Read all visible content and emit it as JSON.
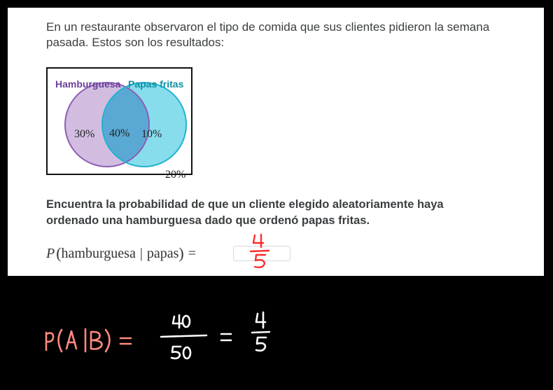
{
  "problem": {
    "intro": "En un restaurante observaron el tipo de comida que sus clientes pidieron la semana pasada. Estos son los resultados:",
    "venn": {
      "set_a_label": "Hamburguesa",
      "set_b_label": "Papas fritas",
      "only_a": "30%",
      "both": "40%",
      "only_b": "10%",
      "neither": "20%",
      "colors": {
        "set_a_fill": "#d2bde0",
        "set_a_stroke": "#8e5cb5",
        "set_a_label": "#6b3f9a",
        "set_b_fill": "#7ad9ea",
        "set_b_stroke": "#1fb3cf",
        "set_b_label": "#0f8fa6",
        "overlap_fill": "#5aa9d4"
      }
    },
    "question": "Encuentra la probabilidad de que un cliente elegido aleatoriamente haya ordenado una hamburguesa dado que ordenó papas fritas.",
    "equation": {
      "p": "P",
      "open": "(",
      "event": "hamburguesa",
      "bar": "|",
      "given": "papas",
      "close": ")",
      "equals": "="
    },
    "answer_input": {
      "value": ""
    },
    "handwritten_answer": {
      "numerator": "4",
      "denominator": "5",
      "color": "#ff2d2d"
    }
  },
  "scratchpad": {
    "expression_left": "P(A|B)",
    "equals_1": "=",
    "fraction_1_numerator": "40",
    "fraction_1_denominator": "50",
    "equals_2": "=",
    "fraction_2_numerator": "4",
    "fraction_2_denominator": "5",
    "ink_color_left": "#ff8a80",
    "ink_color_right": "#ffffff"
  }
}
